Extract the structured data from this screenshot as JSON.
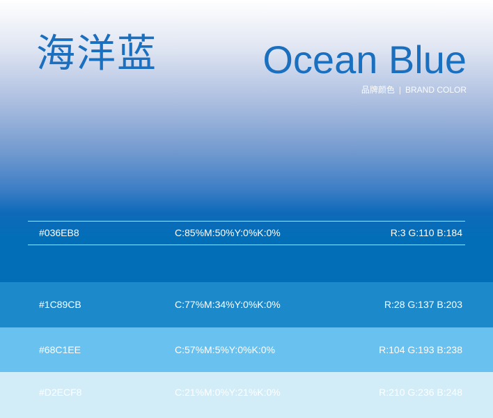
{
  "header": {
    "title_cn": "海洋蓝",
    "title_en": "Ocean Blue",
    "subtitle_cn": "品牌颜色",
    "separator": "|",
    "subtitle_en": "BRAND COLOR"
  },
  "colors": [
    {
      "hex": "#036EB8",
      "cmyk": "C:85%M:50%Y:0%K:0%",
      "rgb": "R:3 G:110 B:184",
      "swatch": "#036eb8",
      "text_color": "#ffffff"
    },
    {
      "hex": "#1C89CB",
      "cmyk": "C:77%M:34%Y:0%K:0%",
      "rgb": "R:28 G:137 B:203",
      "swatch": "#1c89cb",
      "text_color": "#ffffff"
    },
    {
      "hex": "#68C1EE",
      "cmyk": "C:57%M:5%Y:0%K:0%",
      "rgb": "R:104 G:193 B:238",
      "swatch": "#68c1ee",
      "text_color": "#ffffff"
    },
    {
      "hex": "#D2ECF8",
      "cmyk": "C:21%M:0%Y:21%K:0%",
      "rgb": "R:210 G:236 B:248",
      "swatch": "#d2ecf8",
      "text_color": "#ffffff"
    }
  ]
}
